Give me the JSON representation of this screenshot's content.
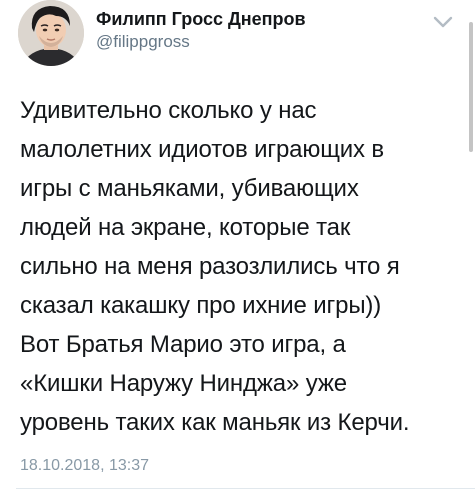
{
  "author": {
    "display_name": "Филипп Гросс Днепров",
    "handle": "@filippgross",
    "avatar_icon": "profile-avatar"
  },
  "menu": {
    "icon": "chevron-down-icon",
    "color": "#b3bcc4"
  },
  "tweet": {
    "lines": [
      "Удивительно сколько у нас",
      "малолетних идиотов играющих в",
      "игры с маньяками, убивающих",
      "людей на экране, которые так",
      "сильно на меня разозлились что я",
      "сказал какашку про ихние игры))",
      "Вот Братья Марио это игра, а",
      "«Кишки Наружу Нинджа» уже",
      "уровень таких как маньяк из Керчи."
    ],
    "timestamp": "18.10.2018, 13:37"
  },
  "colors": {
    "text": "#14171a",
    "secondary": "#657786",
    "timestamp": "#8899a6",
    "divider": "#e1e8ed"
  }
}
